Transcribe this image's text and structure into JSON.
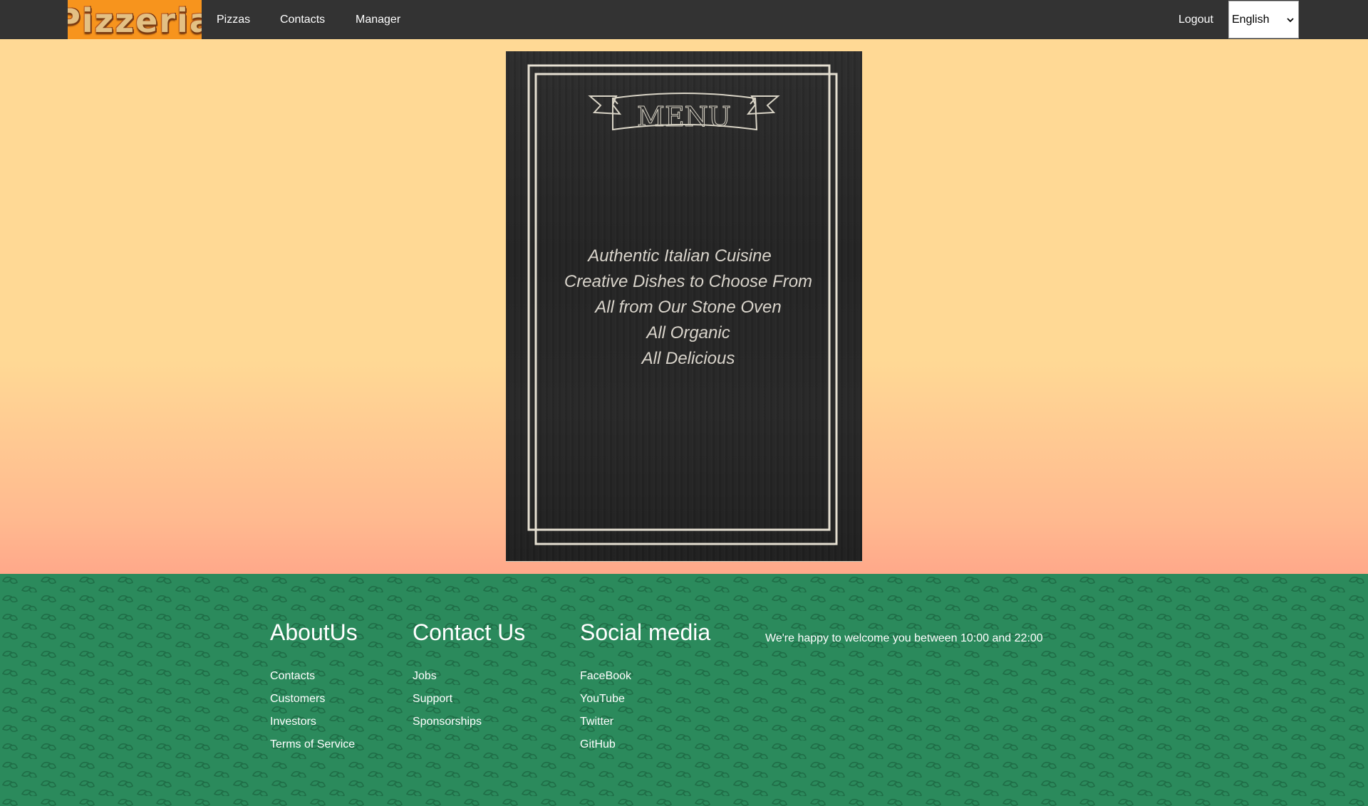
{
  "navbar": {
    "logo_text": "Pizzeria",
    "links": {
      "pizzas": "Pizzas",
      "contacts": "Contacts",
      "manager": "Manager"
    },
    "logout": "Logout",
    "language": {
      "selected": "English",
      "icon": "chevron-down-icon"
    }
  },
  "menu_board": {
    "title": "MENU",
    "lines": [
      "Authentic Italian Cuisine",
      "Creative Dishes to Choose From",
      "All from Our Stone Oven",
      "All Organic",
      "All Delicious"
    ]
  },
  "footer": {
    "about": {
      "heading": "AboutUs",
      "links": [
        "Contacts",
        "Customers",
        "Investors",
        "Terms of Service"
      ]
    },
    "contact": {
      "heading": "Contact Us",
      "links": [
        "Jobs",
        "Support",
        "Sponsorships"
      ]
    },
    "social": {
      "heading": "Social media",
      "links": [
        "FaceBook",
        "YouTube",
        "Twitter",
        "GitHub"
      ]
    },
    "welcome": "We're happy to welcome you between 10:00 and 22:00"
  },
  "colors": {
    "navbar_bg": "#333333",
    "logo_bg": "#f7941d",
    "page_bg": "#ffd995",
    "footer_bg": "#2b8a5c",
    "board_bg": "#252525",
    "board_text": "#d9d4cb"
  }
}
